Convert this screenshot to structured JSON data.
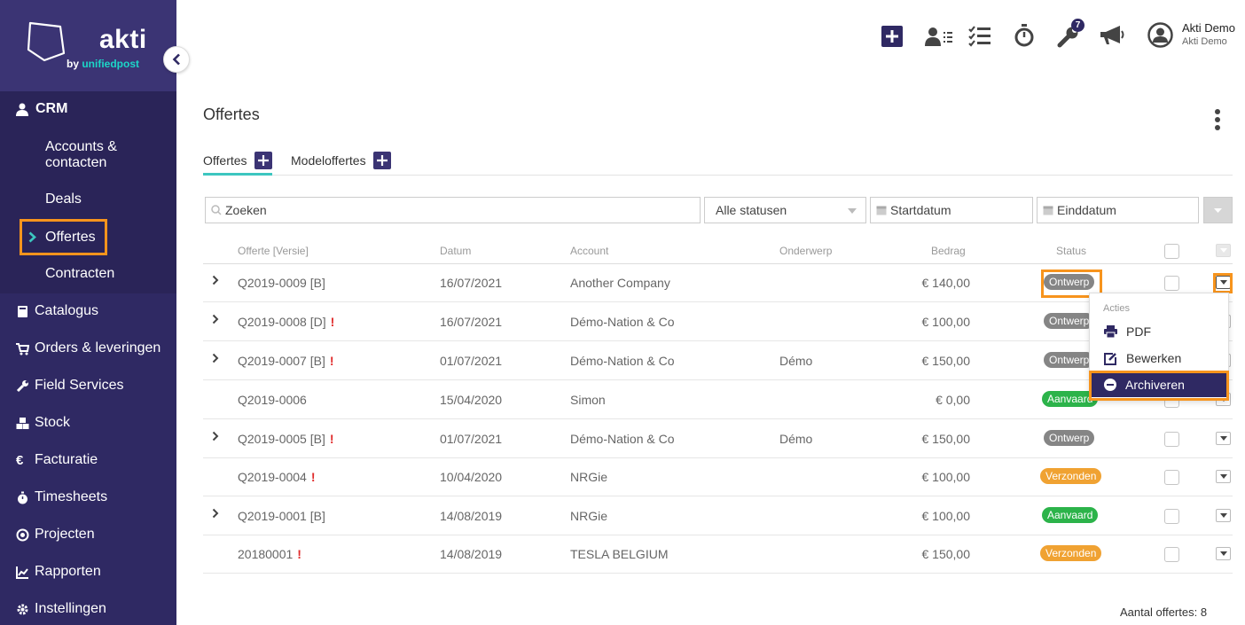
{
  "brand": {
    "name": "akti",
    "sub_prefix": "by ",
    "sub_name": "unifiedpost"
  },
  "sidebar": {
    "crm": "CRM",
    "crm_items": [
      "Accounts &",
      "contacten",
      "Deals",
      "Offertes",
      "Contracten"
    ],
    "items": [
      "Catalogus",
      "Orders & leveringen",
      "Field Services",
      "Stock",
      "Facturatie",
      "Timesheets",
      "Projecten",
      "Rapporten",
      "Instellingen"
    ]
  },
  "header": {
    "badge": "7",
    "user_name": "Akti Demo",
    "user_company": "Akti Demo"
  },
  "page": {
    "title": "Offertes",
    "tabs": [
      "Offertes",
      "Modeloffertes"
    ],
    "search_placeholder": "Zoeken",
    "status_filter": "Alle statusen",
    "start_date": "Startdatum",
    "end_date": "Einddatum"
  },
  "table": {
    "columns": [
      "Offerte [Versie]",
      "Datum",
      "Account",
      "Onderwerp",
      "Bedrag",
      "Status"
    ],
    "rows": [
      {
        "id": "Q2019-0009 [B]",
        "date": "16/07/2021",
        "account": "Another Company",
        "subject": "",
        "amount": "€ 140,00",
        "status": "Ontwerp"
      },
      {
        "id": "Q2019-0008 [D]",
        "date": "16/07/2021",
        "account": "Démo-Nation & Co",
        "subject": "",
        "amount": "€ 100,00",
        "status": "Ontwerp"
      },
      {
        "id": "Q2019-0007 [B]",
        "date": "01/07/2021",
        "account": "Démo-Nation & Co",
        "subject": "Démo",
        "amount": "€ 150,00",
        "status": "Ontwerp"
      },
      {
        "id": "Q2019-0006",
        "date": "15/04/2020",
        "account": "Simon",
        "subject": "",
        "amount": "€ 0,00",
        "status": "Aanvaard"
      },
      {
        "id": "Q2019-0005 [B]",
        "date": "01/07/2021",
        "account": "Démo-Nation & Co",
        "subject": "Démo",
        "amount": "€ 150,00",
        "status": "Ontwerp"
      },
      {
        "id": "Q2019-0004",
        "date": "10/04/2020",
        "account": "NRGie",
        "subject": "",
        "amount": "€ 100,00",
        "status": "Verzonden"
      },
      {
        "id": "Q2019-0001 [B]",
        "date": "14/08/2019",
        "account": "NRGie",
        "subject": "",
        "amount": "€ 100,00",
        "status": "Aanvaard"
      },
      {
        "id": "20180001",
        "date": "14/08/2019",
        "account": "TESLA BELGIUM",
        "subject": "",
        "amount": "€ 150,00",
        "status": "Verzonden"
      }
    ],
    "excl": "!"
  },
  "menu": {
    "header": "Acties",
    "pdf": "PDF",
    "edit": "Bewerken",
    "archive": "Archiveren"
  },
  "footer": {
    "label": "Aantal offertes:",
    "count": "8"
  },
  "colors": {
    "sidebar": "#2f2963",
    "accent": "#3cc6c0",
    "highlight": "#f7941d"
  }
}
